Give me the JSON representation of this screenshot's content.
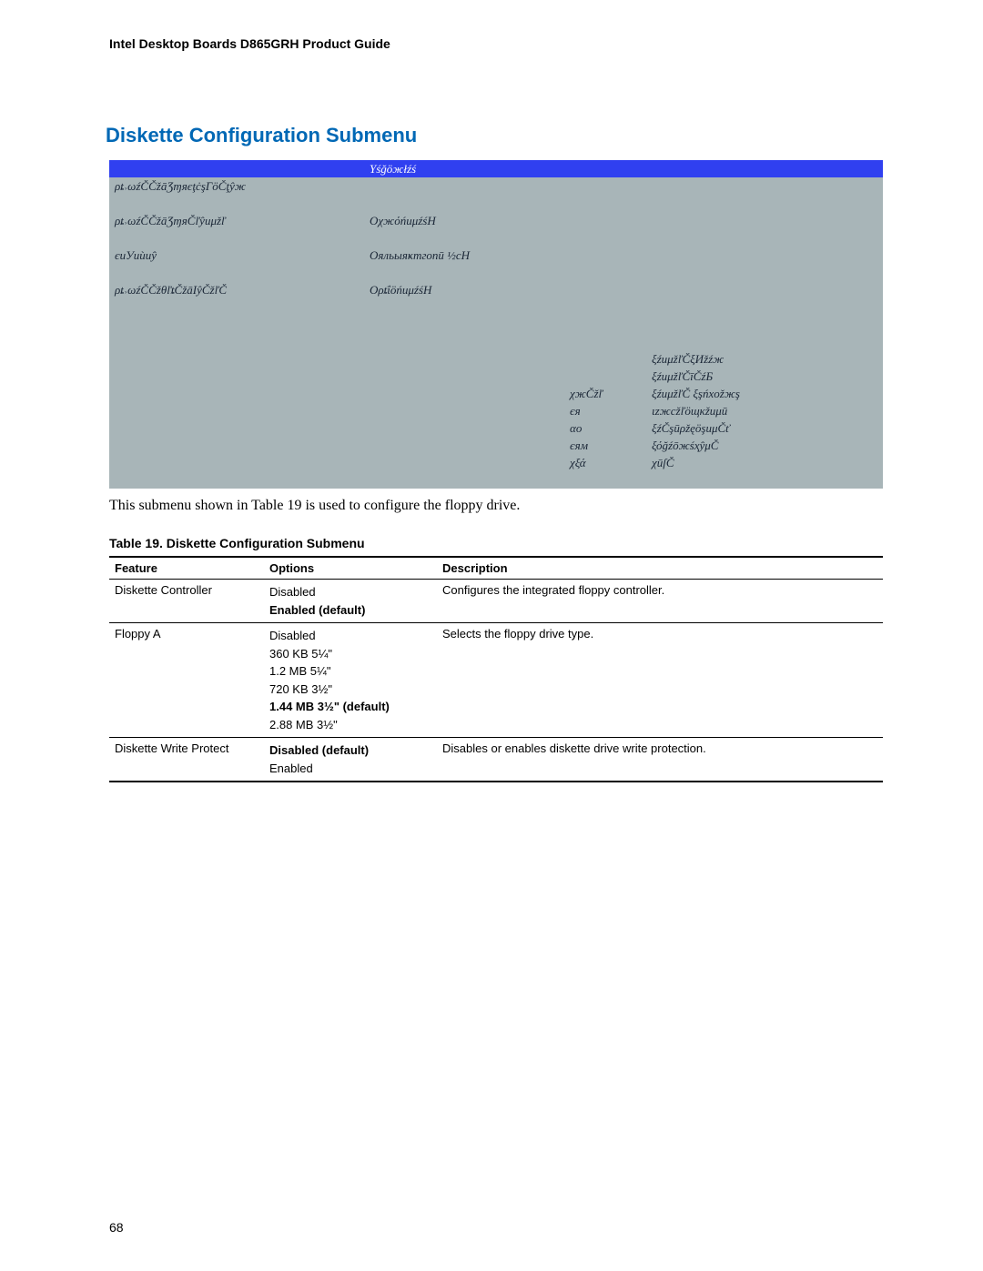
{
  "header": "Intel Desktop Boards D865GRH Product Guide",
  "section_title": "Diskette Configuration Submenu",
  "bios": {
    "header_center": "Yśğöжłźś",
    "rows": [
      {
        "l": "ρȶ˒ωźČČžāƷɱяєţċşГöČţŷж",
        "m": "",
        "r1": "",
        "r2": ""
      },
      {
        "l": "",
        "m": "",
        "r1": "",
        "r2": ""
      },
      {
        "l": "ρȶ˒ωźČČžāƷɱяČľŷиμžľ",
        "m": "ОχжόńиμźśH",
        "r1": "",
        "r2": ""
      },
      {
        "l": "",
        "m": "",
        "r1": "",
        "r2": ""
      },
      {
        "l": "єиУиùиŷ",
        "m": "Ояльыяҝтгопū   ½cH",
        "r1": "",
        "r2": ""
      },
      {
        "l": "",
        "m": "",
        "r1": "",
        "r2": ""
      },
      {
        "l": "ρȶ˒ωźČČžθľȶČžāΙŷČžľČ",
        "m": "ОρȶΐöńиμźśH",
        "r1": "",
        "r2": ""
      },
      {
        "l": "",
        "m": "",
        "r1": "",
        "r2": ""
      },
      {
        "l": "",
        "m": "",
        "r1": "",
        "r2": ""
      },
      {
        "l": "",
        "m": "",
        "r1": "",
        "r2": ""
      },
      {
        "l": "",
        "m": "",
        "r1": "",
        "r2": "ξźиμžľČξИžźж"
      },
      {
        "l": "",
        "m": "",
        "r1": "",
        "r2": "ξźиμžľČīČźБ"
      },
      {
        "l": "",
        "m": "",
        "r1": "χжČžľ",
        "r2": "ξźиμžľČ    ξşńxоžжş"
      },
      {
        "l": "",
        "m": "",
        "r1": "єя",
        "r2": "ιzжcžľöщкžиμū"
      },
      {
        "l": "",
        "m": "",
        "r1": "αо",
        "r2": "ξźČşūρžęöşиμČť"
      },
      {
        "l": "",
        "m": "",
        "r1": "єям",
        "r2": "ξόğźōжśҳŷμČ"
      },
      {
        "l": "",
        "m": "",
        "r1": "χξά",
        "r2": "χūſČ"
      },
      {
        "l": "",
        "m": "",
        "r1": "",
        "r2": ""
      }
    ]
  },
  "caption": "This submenu shown in Table 19 is used to configure the floppy drive.",
  "table_title": "Table 19.    Diskette Configuration Submenu",
  "table": {
    "head": {
      "feature": "Feature",
      "options": "Options",
      "description": "Description"
    },
    "rows": [
      {
        "feature": "Diskette Controller",
        "options": [
          {
            "text": "Disabled",
            "bold": false
          },
          {
            "text": "Enabled (default)",
            "bold": true
          }
        ],
        "desc": "Configures the integrated floppy controller."
      },
      {
        "feature": "Floppy A",
        "options": [
          {
            "text": "Disabled",
            "bold": false
          },
          {
            "text": "360 KB 5¼\"",
            "bold": false
          },
          {
            "text": "1.2 MB 5¼\"",
            "bold": false
          },
          {
            "text": "720 KB 3½\"",
            "bold": false
          },
          {
            "text": "1.44 MB 3½\" (default)",
            "bold": true
          },
          {
            "text": "2.88 MB 3½\"",
            "bold": false
          }
        ],
        "desc": "Selects the floppy drive type."
      },
      {
        "feature": "Diskette Write Protect",
        "options": [
          {
            "text": "Disabled (default)",
            "bold": true
          },
          {
            "text": "Enabled",
            "bold": false
          }
        ],
        "desc": "Disables or enables diskette drive write protection."
      }
    ]
  },
  "page_number": "68"
}
